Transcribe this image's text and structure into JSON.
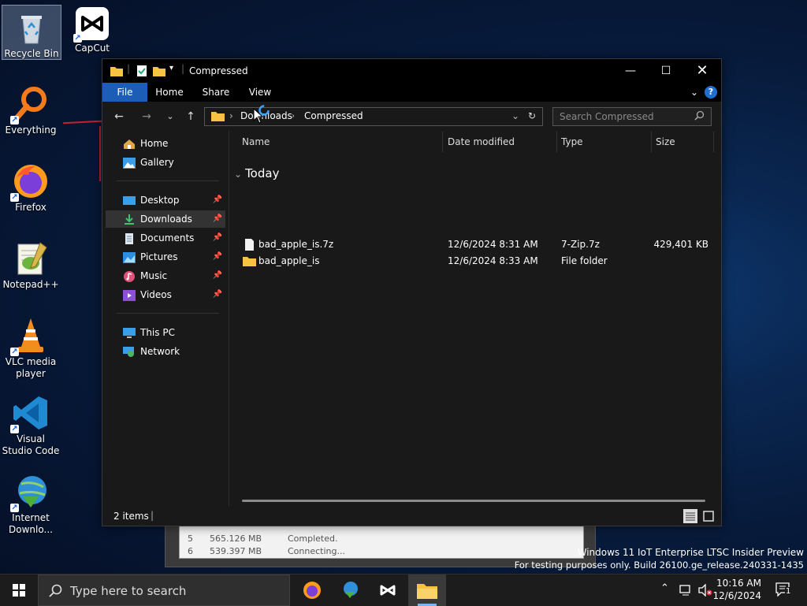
{
  "desktop": {
    "icons": [
      {
        "label": "Recycle Bin"
      },
      {
        "label": "CapCut"
      },
      {
        "label": "Everything"
      },
      {
        "label": "Firefox"
      },
      {
        "label": "Notepad++"
      },
      {
        "label": "VLC media player"
      },
      {
        "label": "Visual Studio Code"
      },
      {
        "label": "Internet Downlo..."
      }
    ]
  },
  "bg_window": {
    "rows": [
      {
        "num": "5",
        "size": "565.126  MB",
        "status": "Completed."
      },
      {
        "num": "6",
        "size": "539.397  MB",
        "status": "Connecting..."
      }
    ]
  },
  "explorer": {
    "title": "Compressed",
    "ribbon_tabs": [
      "File",
      "Home",
      "Share",
      "View"
    ],
    "address": {
      "seg1": "Downloads",
      "seg2": "Compressed"
    },
    "search_placeholder": "Search Compressed",
    "nav": {
      "home": "Home",
      "gallery": "Gallery",
      "desktop": "Desktop",
      "downloads": "Downloads",
      "documents": "Documents",
      "pictures": "Pictures",
      "music": "Music",
      "videos": "Videos",
      "thispc": "This PC",
      "network": "Network"
    },
    "columns": {
      "name": "Name",
      "date": "Date modified",
      "type": "Type",
      "size": "Size"
    },
    "group": "Today",
    "files": [
      {
        "name": "bad_apple_is.7z",
        "date": "12/6/2024 8:31 AM",
        "type": "7-Zip.7z",
        "size": "429,401 KB"
      },
      {
        "name": "bad_apple_is",
        "date": "12/6/2024 8:33 AM",
        "type": "File folder",
        "size": ""
      }
    ],
    "status": "2 items"
  },
  "watermark": {
    "line1": "Windows 11 IoT Enterprise LTSC Insider Preview",
    "line2": "For testing purposes only. Build 26100.ge_release.240331-1435"
  },
  "taskbar": {
    "search_placeholder": "Type here to search",
    "time": "10:16 AM",
    "date": "12/6/2024",
    "notif_count": "1"
  },
  "colors": {
    "accent": "#1c5db5",
    "window_bg": "#191919"
  }
}
